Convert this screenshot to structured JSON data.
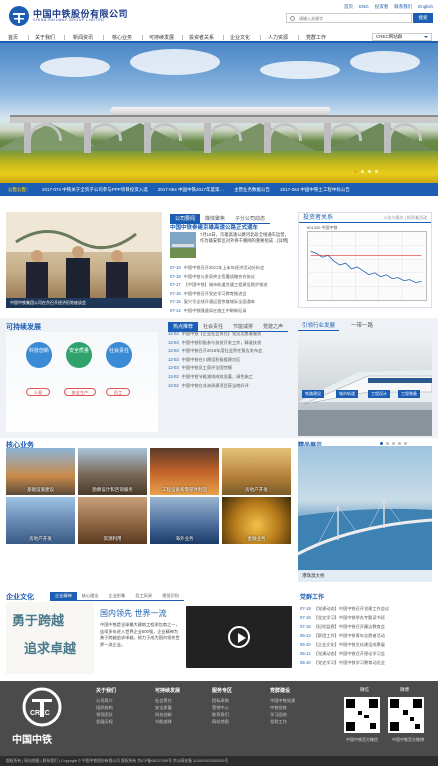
{
  "header": {
    "logo_cn": "中国中铁股份有限公司",
    "logo_en": "CHINA RAILWAY GROUP LIMITED",
    "links": [
      "首页",
      "ENG",
      "投资者",
      "联系我们",
      "English"
    ],
    "search_placeholder": "请输入关键字",
    "search_button": "搜索"
  },
  "nav": {
    "items": [
      "首页",
      "关于我们",
      "新闻资讯",
      "核心业务",
      "可持续发展",
      "投资者关系",
      "企业文化",
      "人力资源",
      "党群工作"
    ],
    "select_value": "CREC网站群"
  },
  "notice": {
    "label": "公告公告：",
    "items": [
      "2017-074 中铁关于全资子公司参与PPP项目投资入选",
      "2017-064 中国中铁2017年度第…",
      "主营业务数据公告",
      "2017-063 中国中铁土工程中标公告"
    ]
  },
  "news": {
    "image_caption": "中国中铁集团公司在京召开经济形势座谈会",
    "tabs": [
      "公司要闻",
      "媒体聚焦",
      "子分公司动态"
    ],
    "headline": "中国中铁参建京雄高速公路正式通车",
    "summary": "7月15日，京雄高速公路河北段全线通车运营，作为雄安新区对外骨干路网的重要组成…[详情]",
    "list": [
      {
        "date": "07-19",
        "title": "中国中铁召开2021年上半年经济活动分析会"
      },
      {
        "date": "07-18",
        "title": "中国中铁与多家央企签署战略合作协议"
      },
      {
        "date": "07-17",
        "title": "【中国中铁】城市轨道交通工程建设稳步推进"
      },
      {
        "date": "07-16",
        "title": "中国中铁召开党史学习教育推进会"
      },
      {
        "date": "07-15",
        "title": "复兴号全线开通运营京雄城际全面通车"
      },
      {
        "date": "07-14",
        "title": "中国中铁隧道局在施工中刷新纪录"
      }
    ]
  },
  "investor": {
    "title": "投资者关系",
    "sub": "公告与股东  |  投资者活动",
    "stock_label": "601390 中国中铁"
  },
  "sustain": {
    "title": "可持续发展",
    "circles": [
      "科技创新",
      "安全质量",
      "社会责任"
    ],
    "ovals": [
      "人权",
      "安全生产",
      "员工"
    ],
    "tabs": [
      "热点推荐",
      "社会责任",
      "节能减排",
      "党建之声"
    ],
    "hot": [
      {
        "date": "12-03",
        "title": "中国中铁【企业社会责任】党员志愿者服务"
      },
      {
        "date": "12-03",
        "title": "中国中铁积极参与扶贫开发工作，精准扶贫"
      },
      {
        "date": "12-03",
        "title": "中国中铁召开2016年度社会责任报告发布会"
      },
      {
        "date": "12-03",
        "title": "中国中铁在川建设积极援建灾区"
      },
      {
        "date": "12-03",
        "title": "中国中铁员工获评全国劳模"
      },
      {
        "date": "12-02",
        "title": "中国中铁节能减排成效显著，绿色施工"
      },
      {
        "date": "12-02",
        "title": "中国中铁在非洲承建项目获当地好评"
      }
    ],
    "right_tabs": [
      "引领行业发展",
      "一带一路"
    ],
    "badges": [
      "铁路建设",
      "城市轨道",
      "工程设计",
      "工程装备"
    ]
  },
  "business": {
    "title": "核心业务",
    "items": [
      "基础设施建设",
      "勘察设计和咨询服务",
      "工程设备和零部件制造",
      "房地产开发",
      "房地产开发",
      "资源利用",
      "海外业务",
      "金融业务"
    ],
    "fine_title": "精品展示",
    "fine_caption": "港珠澳大桥"
  },
  "culture": {
    "title": "企业文化",
    "tabs": [
      "企业精神",
      "核心理念",
      "企业形象",
      "员工风采",
      "视觉识别"
    ],
    "calligraphy": [
      "勇于跨越",
      "追求卓越"
    ],
    "slogan": "国内领先 世界一流",
    "text": "中国中铁是全球最大建筑工程承包商之一，连续多年进入世界企业500强，企业精神为勇于跨越追求卓越，致力于成为国内领先世界一流企业。",
    "party_title": "党群工作",
    "party": [
      {
        "date": "07-19",
        "title": "【党建动态】中国中铁召开党建工作会议"
      },
      {
        "date": "07-16",
        "title": "【党史学习】中国中铁举办专题读书班"
      },
      {
        "date": "07-16",
        "title": "【纪检监察】中国中铁召开廉洁教育会"
      },
      {
        "date": "06-13",
        "title": "【群团工作】中国中铁青年志愿者活动"
      },
      {
        "date": "06-10",
        "title": "【企业文化】中国中铁文化建设成果展"
      },
      {
        "date": "05-12",
        "title": "【党建动态】中国中铁召开理论学习会"
      },
      {
        "date": "05-10",
        "title": "【党史学习】中国中铁学习教育动员会"
      }
    ]
  },
  "footer": {
    "logo_text": "中国中铁",
    "cols": [
      {
        "title": "关于我们",
        "items": [
          "公司简介",
          "组织结构",
          "领导团队",
          "发展历程"
        ]
      },
      {
        "title": "可持续发展",
        "items": [
          "社会责任",
          "安全质量",
          "科技创新",
          "节能减排"
        ]
      },
      {
        "title": "服务专区",
        "items": [
          "招标采购",
          "营销中心",
          "联系我们",
          "网站地图"
        ]
      },
      {
        "title": "党群建设",
        "items": [
          "中国中铁党建",
          "中铁党校",
          "学习园地",
          "党群工作"
        ]
      }
    ],
    "qr": [
      "微信",
      "微博"
    ],
    "qr_labels": [
      "中国中铁官方微信",
      "中国中铁官方微博"
    ],
    "bottom": "版权所有  |  网站地图  |  联系我们  |  Copyright © 中国中铁股份有限公司 版权所有 京ICP备05037059号  京公网安备 110000000000000号"
  }
}
